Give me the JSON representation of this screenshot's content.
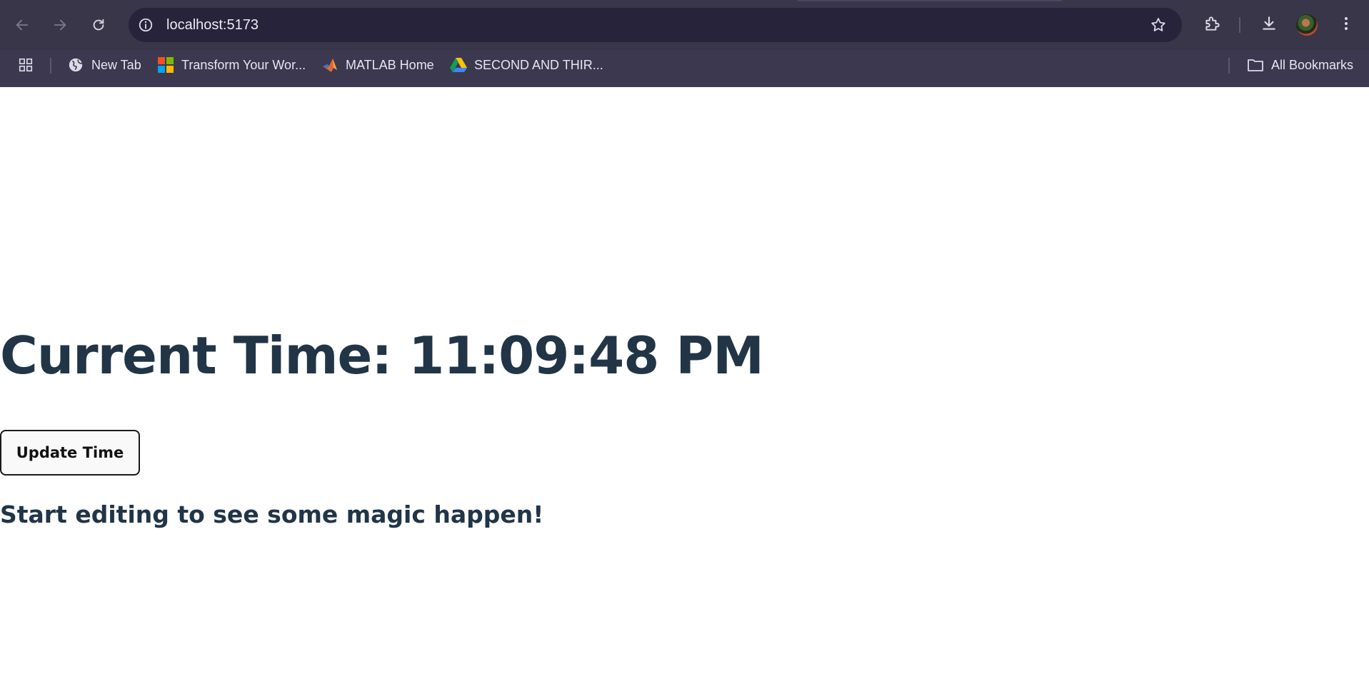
{
  "browser": {
    "url": "localhost:5173",
    "toolbar": {
      "back_icon": "arrow-left-icon",
      "forward_icon": "arrow-right-icon",
      "reload_icon": "reload-icon",
      "site_info_icon": "info-icon",
      "bookmark_star_icon": "star-icon",
      "extensions_icon": "puzzle-icon",
      "downloads_icon": "download-icon",
      "menu_icon": "kebab-menu-icon"
    },
    "bookmarks": [
      {
        "label": "New Tab",
        "icon": "globe-icon"
      },
      {
        "label": "Transform Your Wor...",
        "icon": "microsoft-logo-icon"
      },
      {
        "label": "MATLAB Home",
        "icon": "matlab-logo-icon"
      },
      {
        "label": "SECOND AND THIR...",
        "icon": "google-drive-icon"
      }
    ],
    "all_bookmarks_label": "All Bookmarks",
    "apps_icon": "apps-grid-icon",
    "colors": {
      "frame": "#3a3649",
      "omnibox": "#26233a",
      "text": "#ecebf2"
    }
  },
  "page": {
    "time_heading": "Current Time: 11:09:48 PM",
    "update_button_label": "Update Time",
    "magic_text": "Start editing to see some magic happen!",
    "colors": {
      "heading": "#213547",
      "button_border": "#1a1a1a",
      "button_bg": "#f9f9f9"
    }
  }
}
